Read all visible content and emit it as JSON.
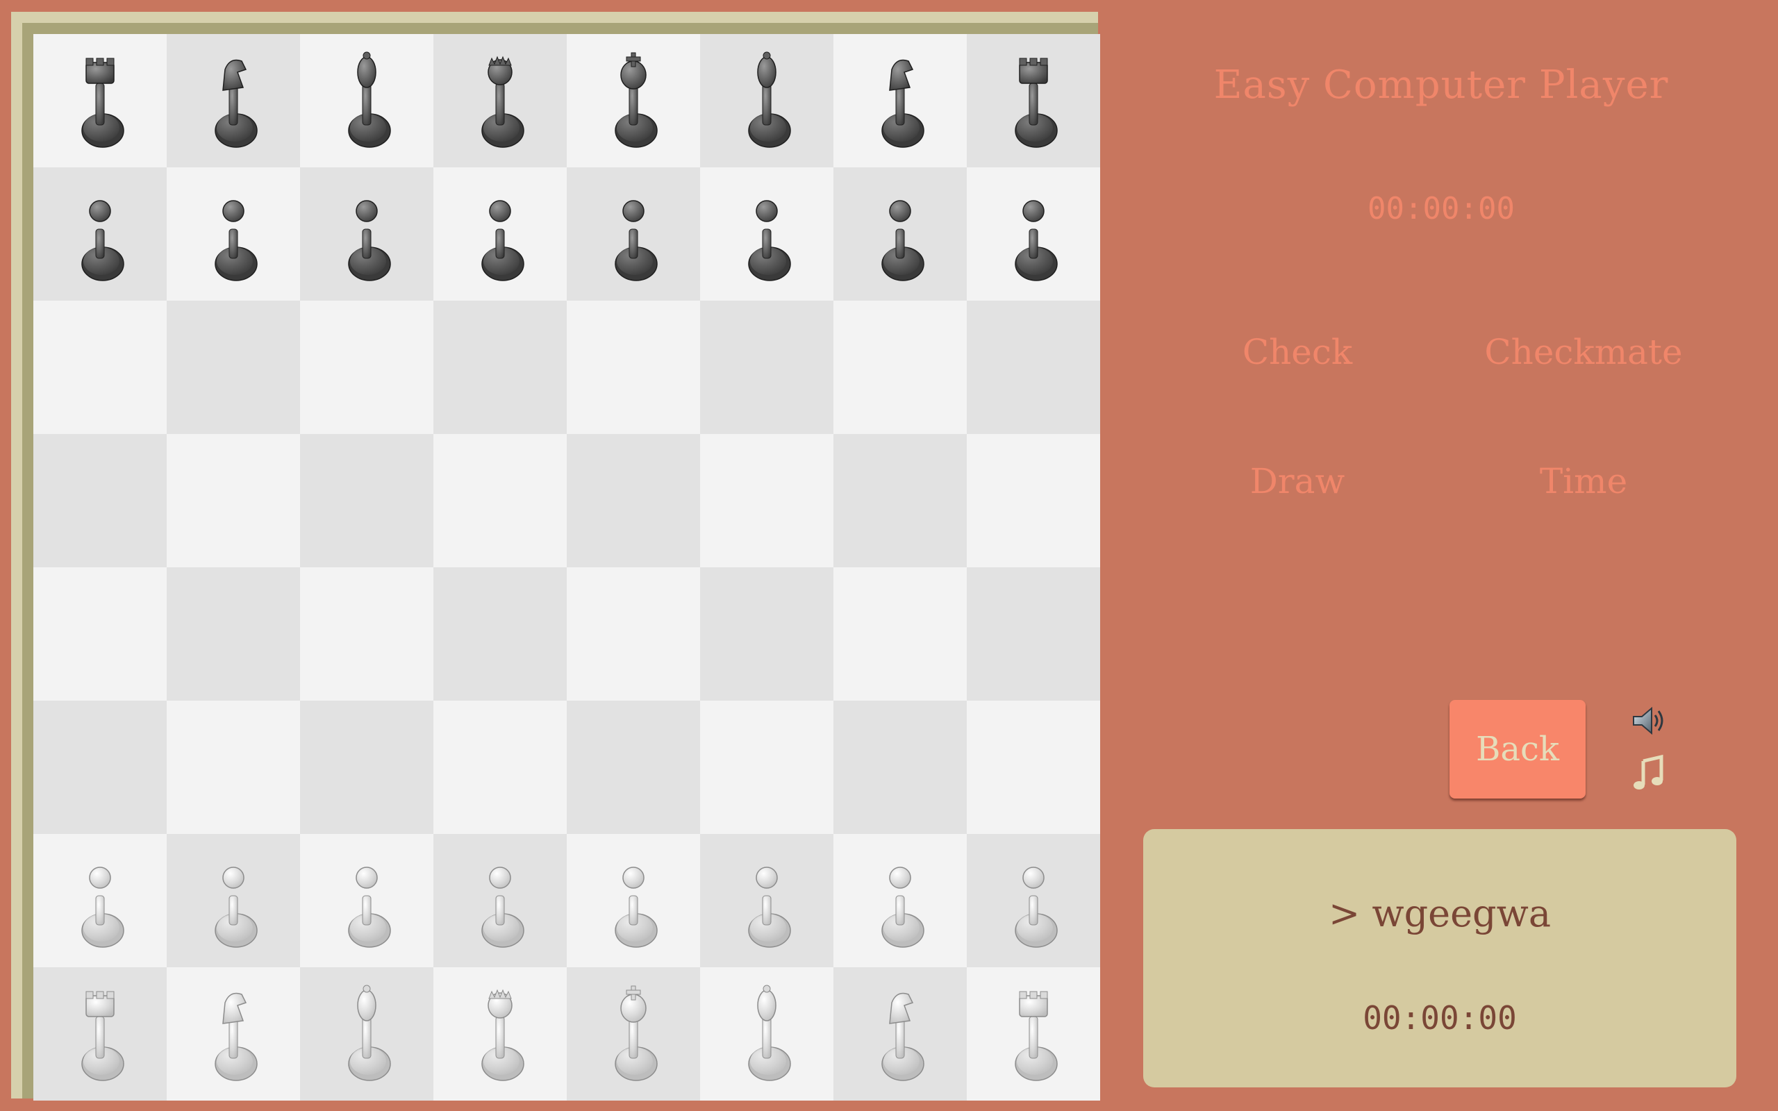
{
  "game": {
    "title": "Easy Computer Player",
    "opponent_timer": "00:00:00",
    "player_timer": "00:00:00",
    "console_prompt": "> wgeegwa"
  },
  "status_labels": {
    "check": "Check",
    "checkmate": "Checkmate",
    "draw": "Draw",
    "time": "Time"
  },
  "controls": {
    "back_label": "Back",
    "sound_icon": "speaker-icon",
    "music_icon": "music-note-icon"
  },
  "colors": {
    "background": "#C8765E",
    "accent": "#F0866A",
    "button": "#F8866A",
    "console_bg": "#D5CAA0",
    "console_text": "#7A4636",
    "light_square": "#F3F3F3",
    "dark_square": "#E2E2E2"
  },
  "board": {
    "ranks": [
      [
        "black-rook",
        "black-knight",
        "black-bishop",
        "black-queen",
        "black-king",
        "black-bishop",
        "black-knight",
        "black-rook"
      ],
      [
        "black-pawn",
        "black-pawn",
        "black-pawn",
        "black-pawn",
        "black-pawn",
        "black-pawn",
        "black-pawn",
        "black-pawn"
      ],
      [
        "",
        "",
        "",
        "",
        "",
        "",
        "",
        ""
      ],
      [
        "",
        "",
        "",
        "",
        "",
        "",
        "",
        ""
      ],
      [
        "",
        "",
        "",
        "",
        "",
        "",
        "",
        ""
      ],
      [
        "",
        "",
        "",
        "",
        "",
        "",
        "",
        ""
      ],
      [
        "white-pawn",
        "white-pawn",
        "white-pawn",
        "white-pawn",
        "white-pawn",
        "white-pawn",
        "white-pawn",
        "white-pawn"
      ],
      [
        "white-rook",
        "white-knight",
        "white-bishop",
        "white-queen",
        "white-king",
        "white-bishop",
        "white-knight",
        "white-rook"
      ]
    ]
  }
}
